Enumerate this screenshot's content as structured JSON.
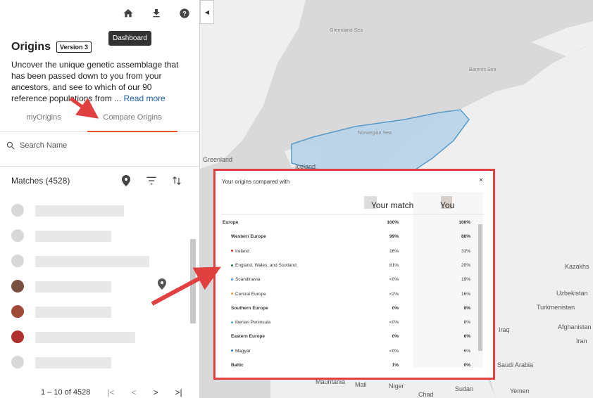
{
  "toolbar": {
    "tooltip": "Dashboard",
    "collapse_glyph": "◀"
  },
  "header": {
    "title": "Origins",
    "version": "Version 3",
    "description": "Uncover the unique genetic assemblage that has been passed down to you from your ancestors, and see to which of our 90 reference populations from ...",
    "read_more": "Read more"
  },
  "tabs": [
    {
      "label": "myOrigins"
    },
    {
      "label": "Compare Origins"
    }
  ],
  "search": {
    "placeholder": "Search Name"
  },
  "matches": {
    "label": "Matches (4528)"
  },
  "pager": {
    "range": "1 – 10 of 4528"
  },
  "map_labels": {
    "greenland_sea": "Greenland Sea",
    "barents_sea": "Barents Sea",
    "norwegian_sea": "Norwegian Sea",
    "greenland": "Greenland",
    "iceland": "Iceland",
    "kazakhstan": "Kazakhs",
    "uzbekistan": "Uzbekistan",
    "turkmenistan": "Turkmenistan",
    "iraq": "Iraq",
    "afghanistan": "Afghanistan",
    "iran": "Iran",
    "saudi_arabia": "Saudi Arabia",
    "mali": "Mali",
    "niger": "Niger",
    "chad": "Chad",
    "sudan": "Sudan",
    "yemen": "Yemen",
    "mauritania": "Mauritania"
  },
  "dialog": {
    "title": "Your origins compared with",
    "close": "×",
    "col_match": "Your match",
    "col_you": "You",
    "rows": [
      {
        "label": "Europe",
        "match": "100%",
        "you": "100%",
        "level": "top"
      },
      {
        "label": "Western Europe",
        "match": "99%",
        "you": "86%",
        "level": "sub"
      },
      {
        "label": "Ireland",
        "match": "16%",
        "you": "31%",
        "level": "leaf",
        "color": "#d93025"
      },
      {
        "label": "England, Wales, and Scotland",
        "match": "81%",
        "you": "20%",
        "level": "leaf",
        "color": "#1e7a2e"
      },
      {
        "label": "Scandinavia",
        "match": "<0%",
        "you": "19%",
        "level": "leaf",
        "color": "#4a90d9"
      },
      {
        "label": "Central Europe",
        "match": "<2%",
        "you": "16%",
        "level": "leaf",
        "color": "#f0a030"
      },
      {
        "label": "Southern Europe",
        "match": "0%",
        "you": "8%",
        "level": "sub"
      },
      {
        "label": "Iberian Peninsula",
        "match": "<0%",
        "you": "8%",
        "level": "leaf",
        "color": "#4ab0c8"
      },
      {
        "label": "Eastern Europe",
        "match": "0%",
        "you": "6%",
        "level": "sub"
      },
      {
        "label": "Magyar",
        "match": "<0%",
        "you": "6%",
        "level": "leaf",
        "color": "#3a7bd5"
      },
      {
        "label": "Baltic",
        "match": "1%",
        "you": "0%",
        "level": "sub"
      }
    ]
  }
}
